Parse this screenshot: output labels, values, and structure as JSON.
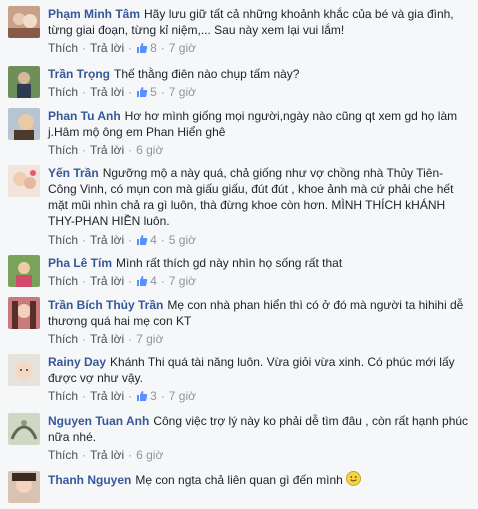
{
  "labels": {
    "like": "Thích",
    "reply": "Trả lời"
  },
  "comments": [
    {
      "author": "Phạm Minh Tâm",
      "text": "Hãy lưu giữ tất cả những khoảnh khắc của bé và gia đình, từng giai đoạn, từng kỉ niệm,... Sau này xem lại vui lắm!",
      "likes": "8",
      "time": "7 giờ"
    },
    {
      "author": "Trần Trọng",
      "text": "Thế thằng điên nào chụp tấm này?",
      "likes": "5",
      "time": "7 giờ"
    },
    {
      "author": "Phan Tu Anh",
      "text": "Hơ hơ mình giống mọi người,ngày nào cũng qt xem gd họ làm j.Hâm mộ ông em Phan Hiển ghê",
      "likes": "",
      "time": "6 giờ"
    },
    {
      "author": "Yến Trần",
      "text": "Ngưỡng mộ a này quá, chả giống như vợ chồng nhà Thủy Tiên-Công Vinh, có mụn con mà giấu giấu, đút đút , khoe ảnh mà cứ phải che hết mặt mũi nhìn chả ra gì luôn, thà đừng khoe còn hơn. MÌNH THÍCH kHÁNH THY-PHAN HIỀN luôn.",
      "likes": "4",
      "time": "5 giờ"
    },
    {
      "author": "Pha Lê Tím",
      "text": "Mình rất thích gd này nhìn họ sống rất that",
      "likes": "4",
      "time": "7 giờ"
    },
    {
      "author": "Trần Bích Thủy Trần",
      "text": "Mẹ con nhà phan hiển thì có ở đó mà người ta hihihi dễ thương quá hai mẹ con KT",
      "likes": "",
      "time": "7 giờ"
    },
    {
      "author": "Rainy Day",
      "text": "Khánh Thi quá tài năng luôn. Vừa giỏi vừa xinh. Có phúc mới lấy được vợ như vậy.",
      "likes": "3",
      "time": "7 giờ"
    },
    {
      "author": "Nguyen Tuan Anh",
      "text": "Công việc trợ lý này ko phải dễ tìm đâu , còn rất hạnh phúc nữa nhé.",
      "likes": "",
      "time": "6 giờ"
    },
    {
      "author": "Thanh Nguyen",
      "text": "Mẹ con ngta chả liên quan gì đến mình",
      "likes": "",
      "time": ""
    }
  ]
}
